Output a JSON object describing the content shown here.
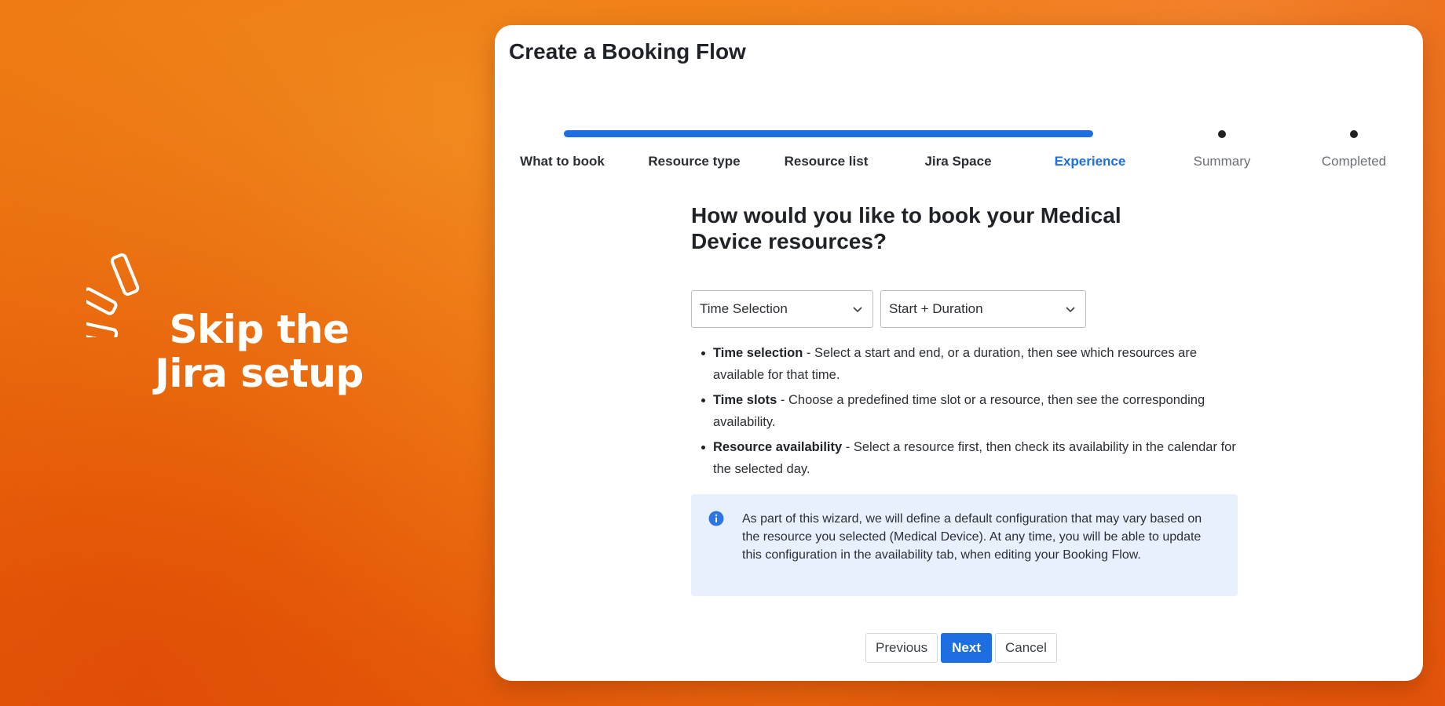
{
  "promo": {
    "line1": "Skip the",
    "line2": "Jira setup"
  },
  "dialog": {
    "title": "Create a Booking Flow"
  },
  "stepper": {
    "progress_percent": 71,
    "steps": [
      {
        "label": "What to book",
        "state": "done"
      },
      {
        "label": "Resource type",
        "state": "done"
      },
      {
        "label": "Resource list",
        "state": "done"
      },
      {
        "label": "Jira Space",
        "state": "done"
      },
      {
        "label": "Experience",
        "state": "active"
      },
      {
        "label": "Summary",
        "state": "pending"
      },
      {
        "label": "Completed",
        "state": "pending"
      }
    ]
  },
  "main": {
    "question": "How would you like to book your Medical Device resources?",
    "select_mode": {
      "value": "Time Selection",
      "icon": "chevron-down-icon"
    },
    "select_duration": {
      "value": "Start + Duration",
      "icon": "chevron-down-icon"
    },
    "options": [
      {
        "term": "Time selection",
        "desc": " - Select a start and end, or a duration, then see which resources are available for that time."
      },
      {
        "term": "Time slots",
        "desc": " - Choose a predefined time slot or a resource, then see the corresponding availability."
      },
      {
        "term": "Resource availability",
        "desc": " - Select a resource first, then check its availability in the calendar for the selected day."
      }
    ],
    "info": {
      "icon": "info-icon",
      "text": "As part of this wizard, we will define a default configuration that may vary based on the resource you selected (Medical Device). At any time, you will be able to update this configuration in the availability tab, when editing your Booking Flow."
    }
  },
  "footer": {
    "previous_label": "Previous",
    "next_label": "Next",
    "cancel_label": "Cancel"
  },
  "colors": {
    "accent": "#1d6ee0",
    "background": "#ee7a12",
    "info_bg": "#e8f0fd"
  }
}
